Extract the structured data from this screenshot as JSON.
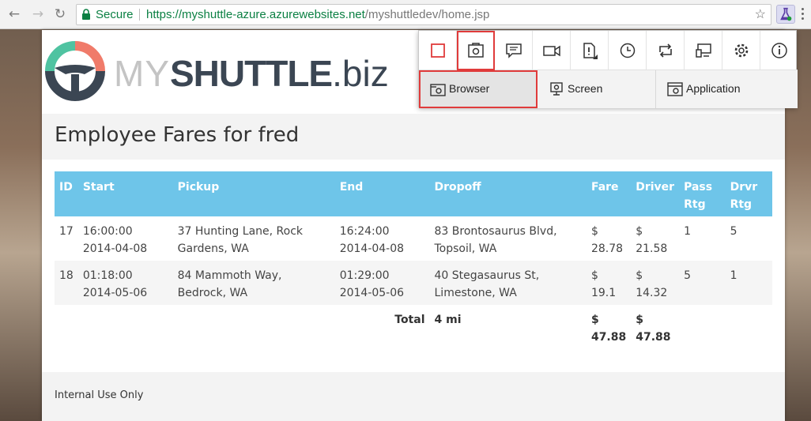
{
  "browser": {
    "secure_label": "Secure",
    "url_host": "https://myshuttle-azure.azurewebsites.net",
    "url_path": "/myshuttledev/home.jsp"
  },
  "logo": {
    "my": "MY",
    "shuttle": "SHUTTLE",
    "biz": ".biz"
  },
  "page": {
    "title": "Employee Fares for fred",
    "footer": "Internal Use Only"
  },
  "table": {
    "headers": [
      "ID",
      "Start",
      "Pickup",
      "End",
      "Dropoff",
      "Fare",
      "Driver",
      "Pass Rtg",
      "Drvr Rtg"
    ],
    "rows": [
      [
        "17",
        "16:00:00 2014-04-08",
        "37 Hunting Lane, Rock Gardens, WA",
        "16:24:00 2014-04-08",
        "83 Brontosaurus Blvd, Topsoil, WA",
        "$ 28.78",
        "$ 21.58",
        "1",
        "5"
      ],
      [
        "18",
        "01:18:00 2014-05-06",
        "84 Mammoth Way, Bedrock, WA",
        "01:29:00 2014-05-06",
        "40 Stegasaurus St, Limestone, WA",
        "$ 19.1",
        "$ 14.32",
        "5",
        "1"
      ]
    ],
    "total": {
      "label": "Total",
      "distance": "4 mi",
      "fare": "$ 47.88",
      "driver": "$ 47.88"
    }
  },
  "capture_toolbar": {
    "tools": [
      "stop-icon",
      "screenshot-icon",
      "note-icon",
      "video-icon",
      "bug-icon",
      "clock-icon",
      "repeat-icon",
      "device-icon",
      "gear-icon",
      "info-icon"
    ],
    "modes": [
      "Browser",
      "Screen",
      "Application"
    ],
    "highlight_color": "#e03b3b"
  },
  "colors": {
    "table_header": "#6ec5e9",
    "logo_teal": "#4fc3a1",
    "logo_coral": "#f07b6a",
    "logo_dark": "#3b4653"
  }
}
